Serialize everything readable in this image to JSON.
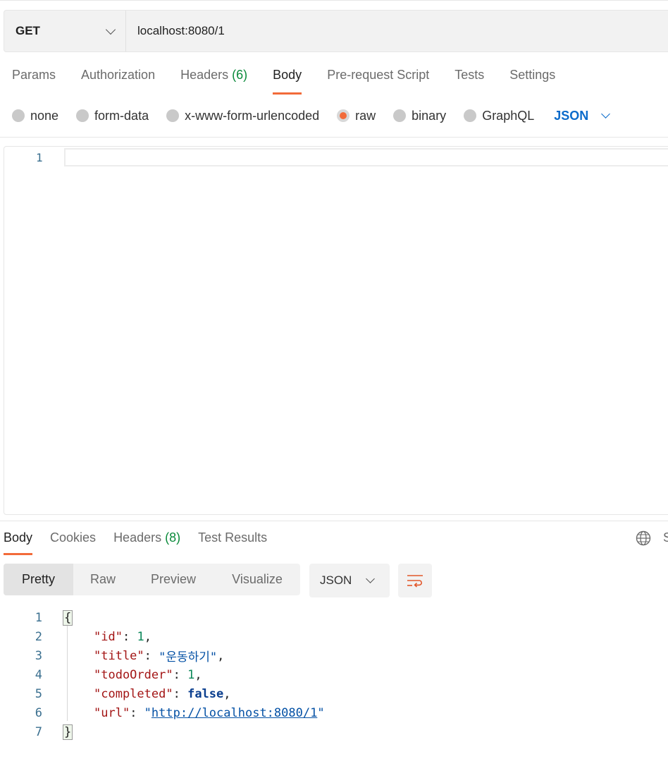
{
  "request": {
    "method": "GET",
    "url": "localhost:8080/1",
    "tabs": [
      "Params",
      "Authorization",
      "Headers",
      "Body",
      "Pre-request Script",
      "Tests",
      "Settings"
    ],
    "headers_count": "(6)",
    "active_tab": "Body",
    "body_types": [
      "none",
      "form-data",
      "x-www-form-urlencoded",
      "raw",
      "binary",
      "GraphQL"
    ],
    "selected_body_type": "raw",
    "body_format": "JSON",
    "editor_line": "1"
  },
  "response": {
    "tabs": [
      "Body",
      "Cookies",
      "Headers",
      "Test Results"
    ],
    "headers_count": "(8)",
    "active_tab": "Body",
    "views": [
      "Pretty",
      "Raw",
      "Preview",
      "Visualize"
    ],
    "active_view": "Pretty",
    "format": "JSON",
    "cut_letter": "S",
    "lines": [
      "1",
      "2",
      "3",
      "4",
      "5",
      "6",
      "7"
    ],
    "json": {
      "open": "{",
      "close": "}",
      "id_key": "\"id\"",
      "id_val": "1",
      "title_key": "\"title\"",
      "title_val": "\"운동하기\"",
      "todoOrder_key": "\"todoOrder\"",
      "todoOrder_val": "1",
      "completed_key": "\"completed\"",
      "completed_val": "false",
      "url_key": "\"url\"",
      "url_val": "http://localhost:8080/1"
    }
  },
  "colors": {
    "accent": "#f26b3a",
    "link": "#0b6bcb",
    "green_count": "#0a8a3a"
  },
  "icons": [
    "chevron-down-icon",
    "globe-icon",
    "wrap-lines-icon"
  ]
}
